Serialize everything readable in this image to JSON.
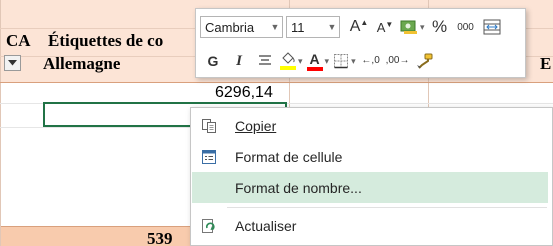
{
  "sheet": {
    "col_header_ca": "CA",
    "col_header_labels": "Étiquettes de co",
    "row_country": "Allemagne",
    "right_edge_letter": "E",
    "cell_value": "6296,14",
    "total_partial": "539",
    "colors": {
      "header_fill": "#fce4d6",
      "total_fill": "#f8cbad",
      "selection_border": "#217346"
    }
  },
  "mini_toolbar": {
    "font_name": "Cambria",
    "font_size": "11",
    "grow_font": "A",
    "shrink_font": "A",
    "bold": "G",
    "italic": "I",
    "font_color_letter": "A",
    "percent": "%",
    "thousands": "000",
    "increase_decimal": ",0",
    "decrease_decimal": ",00",
    "icons": {
      "fill_color": "paint-bucket-icon",
      "font_color": "font-color-icon",
      "align": "align-center-icon",
      "borders": "borders-icon",
      "merge": "merge-center-icon",
      "format_painter": "format-painter-icon",
      "number_format": "accounting-format-icon"
    },
    "colors": {
      "fill_highlight": "#ffff00",
      "font_red": "#ff0000"
    }
  },
  "context_menu": {
    "items": [
      {
        "label": "Copier",
        "mnemonic_index": 0,
        "icon": "copy-icon"
      },
      {
        "label": "Format de cellule",
        "icon": "format-cells-icon"
      },
      {
        "label": "Format de nombre...",
        "mnemonic_char": "d",
        "icon": "",
        "highlighted": true
      },
      {
        "label": "Actualiser",
        "mnemonic_char": "l",
        "icon": "refresh-icon"
      }
    ],
    "highlight_color": "#d5ebdd"
  }
}
